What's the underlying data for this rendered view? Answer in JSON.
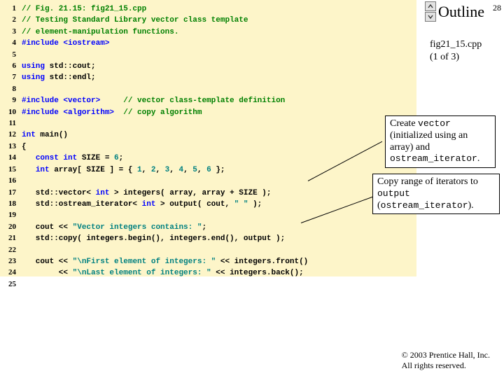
{
  "page_number": "28",
  "outline_label": "Outline",
  "file_label_name": "fig21_15.cpp",
  "file_label_part": "(1 of 3)",
  "callout1_a": "Create ",
  "callout1_b": "vector",
  "callout1_c": " (initialized using an array) and ",
  "callout1_d": "ostream_iterator",
  "callout1_e": ".",
  "callout2_a": "Copy range of iterators to ",
  "callout2_b": "output",
  "callout2_c": " (",
  "callout2_d": "ostream_iterator",
  "callout2_e": ").",
  "footer_line1": "© 2003 Prentice Hall, Inc.",
  "footer_line2": "All rights reserved.",
  "code": [
    {
      "n": "1",
      "segs": [
        {
          "t": "// Fig. 21.15: fig21_15.cpp",
          "c": "cmt"
        }
      ]
    },
    {
      "n": "2",
      "segs": [
        {
          "t": "// Testing Standard Library vector class template",
          "c": "cmt"
        }
      ]
    },
    {
      "n": "3",
      "segs": [
        {
          "t": "// element-manipulation functions.",
          "c": "cmt"
        }
      ]
    },
    {
      "n": "4",
      "segs": [
        {
          "t": "#include <iostream>",
          "c": "kw"
        }
      ]
    },
    {
      "n": "5",
      "segs": [
        {
          "t": "",
          "c": ""
        }
      ]
    },
    {
      "n": "6",
      "segs": [
        {
          "t": "using",
          "c": "kw"
        },
        {
          "t": " std::cout;",
          "c": ""
        }
      ]
    },
    {
      "n": "7",
      "segs": [
        {
          "t": "using",
          "c": "kw"
        },
        {
          "t": " std::endl;",
          "c": ""
        }
      ]
    },
    {
      "n": "8",
      "segs": [
        {
          "t": "",
          "c": ""
        }
      ]
    },
    {
      "n": "9",
      "segs": [
        {
          "t": "#include <vector>",
          "c": "kw"
        },
        {
          "t": "     ",
          "c": ""
        },
        {
          "t": "// vector class-template definition",
          "c": "cmt"
        }
      ]
    },
    {
      "n": "10",
      "segs": [
        {
          "t": "#include <algorithm>",
          "c": "kw"
        },
        {
          "t": "  ",
          "c": ""
        },
        {
          "t": "// copy algorithm",
          "c": "cmt"
        }
      ]
    },
    {
      "n": "11",
      "segs": [
        {
          "t": "",
          "c": ""
        }
      ]
    },
    {
      "n": "12",
      "segs": [
        {
          "t": "int",
          "c": "kw"
        },
        {
          "t": " main()",
          "c": ""
        }
      ]
    },
    {
      "n": "13",
      "segs": [
        {
          "t": "{",
          "c": ""
        }
      ]
    },
    {
      "n": "14",
      "segs": [
        {
          "t": "   ",
          "c": ""
        },
        {
          "t": "const int",
          "c": "kw"
        },
        {
          "t": " SIZE = ",
          "c": ""
        },
        {
          "t": "6",
          "c": "str"
        },
        {
          "t": ";",
          "c": ""
        }
      ]
    },
    {
      "n": "15",
      "segs": [
        {
          "t": "   ",
          "c": ""
        },
        {
          "t": "int",
          "c": "kw"
        },
        {
          "t": " array[ SIZE ] = { ",
          "c": ""
        },
        {
          "t": "1",
          "c": "str"
        },
        {
          "t": ", ",
          "c": ""
        },
        {
          "t": "2",
          "c": "str"
        },
        {
          "t": ", ",
          "c": ""
        },
        {
          "t": "3",
          "c": "str"
        },
        {
          "t": ", ",
          "c": ""
        },
        {
          "t": "4",
          "c": "str"
        },
        {
          "t": ", ",
          "c": ""
        },
        {
          "t": "5",
          "c": "str"
        },
        {
          "t": ", ",
          "c": ""
        },
        {
          "t": "6",
          "c": "str"
        },
        {
          "t": " };",
          "c": ""
        }
      ]
    },
    {
      "n": "16",
      "segs": [
        {
          "t": "",
          "c": ""
        }
      ]
    },
    {
      "n": "17",
      "segs": [
        {
          "t": "   std::vector< ",
          "c": ""
        },
        {
          "t": "int",
          "c": "kw"
        },
        {
          "t": " > integers( array, array + SIZE );",
          "c": ""
        }
      ]
    },
    {
      "n": "18",
      "segs": [
        {
          "t": "   std::ostream_iterator< ",
          "c": ""
        },
        {
          "t": "int",
          "c": "kw"
        },
        {
          "t": " > output( cout, ",
          "c": ""
        },
        {
          "t": "\" \"",
          "c": "str"
        },
        {
          "t": " );",
          "c": ""
        }
      ]
    },
    {
      "n": "19",
      "segs": [
        {
          "t": "",
          "c": ""
        }
      ]
    },
    {
      "n": "20",
      "segs": [
        {
          "t": "   cout << ",
          "c": ""
        },
        {
          "t": "\"Vector integers contains: \"",
          "c": "str"
        },
        {
          "t": ";",
          "c": ""
        }
      ]
    },
    {
      "n": "21",
      "segs": [
        {
          "t": "   std::copy( integers.begin(), integers.end(), output );",
          "c": ""
        }
      ]
    },
    {
      "n": "22",
      "segs": [
        {
          "t": "",
          "c": ""
        }
      ]
    },
    {
      "n": "23",
      "segs": [
        {
          "t": "   cout << ",
          "c": ""
        },
        {
          "t": "\"\\nFirst element of integers: \"",
          "c": "str"
        },
        {
          "t": " << integers.front()",
          "c": ""
        }
      ]
    },
    {
      "n": "24",
      "segs": [
        {
          "t": "        << ",
          "c": ""
        },
        {
          "t": "\"\\nLast element of integers: \"",
          "c": "str"
        },
        {
          "t": " << integers.back();",
          "c": ""
        }
      ]
    },
    {
      "n": "25",
      "segs": [
        {
          "t": "",
          "c": ""
        }
      ]
    }
  ]
}
